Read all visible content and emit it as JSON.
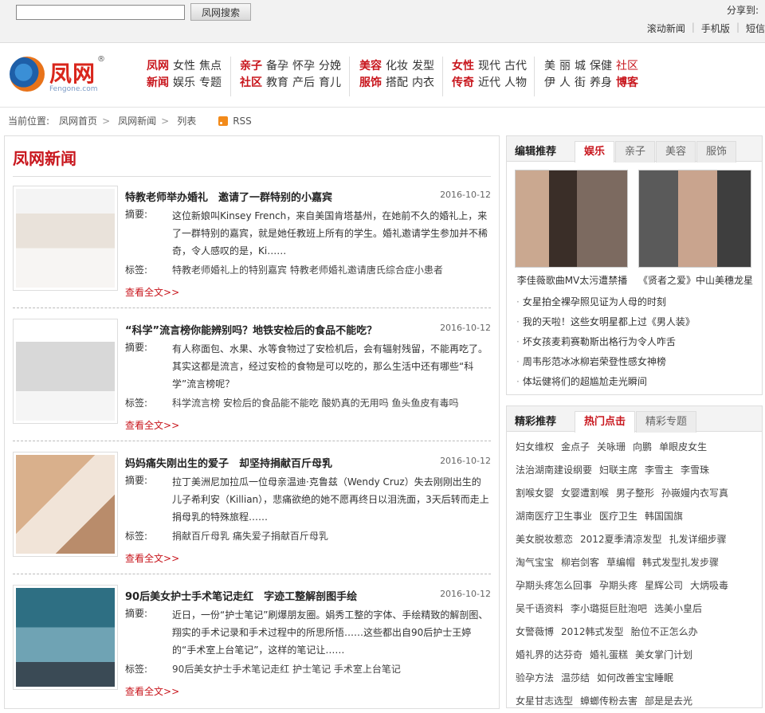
{
  "topbar": {
    "search_value": "",
    "search_button": "凤网搜索",
    "share_label": "分享到:",
    "links": [
      "滚动新闻",
      "手机版",
      "短信"
    ]
  },
  "logo": {
    "name": "凤网",
    "domain": "Fengone.com",
    "reg": "®"
  },
  "nav": {
    "groups": [
      {
        "row1": [
          {
            "t": "凤网",
            "hot": true
          },
          {
            "t": "女性"
          },
          {
            "t": "焦点"
          }
        ],
        "row2": [
          {
            "t": "新闻",
            "hot": true
          },
          {
            "t": "娱乐"
          },
          {
            "t": "专题"
          }
        ]
      },
      {
        "row1": [
          {
            "t": "亲子",
            "hot": true
          },
          {
            "t": "备孕"
          },
          {
            "t": "怀孕"
          },
          {
            "t": "分娩"
          }
        ],
        "row2": [
          {
            "t": "社区",
            "hot": true
          },
          {
            "t": "教育"
          },
          {
            "t": "产后"
          },
          {
            "t": "育儿"
          }
        ]
      },
      {
        "row1": [
          {
            "t": "美容",
            "hot": true
          },
          {
            "t": "化妆"
          },
          {
            "t": "发型"
          }
        ],
        "row2": [
          {
            "t": "服饰",
            "hot": true
          },
          {
            "t": "搭配"
          },
          {
            "t": "内衣"
          }
        ]
      },
      {
        "row1": [
          {
            "t": "女性",
            "hot": true
          },
          {
            "t": "现代"
          },
          {
            "t": "古代"
          }
        ],
        "row2": [
          {
            "t": "传奇",
            "hot": true
          },
          {
            "t": "近代"
          },
          {
            "t": "人物"
          }
        ]
      },
      {
        "row1": [
          {
            "t": "美"
          },
          {
            "t": "丽"
          },
          {
            "t": "城"
          },
          {
            "t": "保健"
          },
          {
            "t": "社区",
            "accent": true
          }
        ],
        "row2": [
          {
            "t": "伊"
          },
          {
            "t": "人"
          },
          {
            "t": "街"
          },
          {
            "t": "养身"
          },
          {
            "t": "博客",
            "hot": true
          }
        ]
      }
    ]
  },
  "breadcrumb": {
    "label": "当前位置:",
    "items": [
      "凤网首页",
      "凤网新闻",
      "列表"
    ],
    "rss": "RSS"
  },
  "main": {
    "title": "凤网新闻",
    "summary_label": "摘要:",
    "tags_label": "标签:",
    "more_label": "查看全文",
    "articles": [
      {
        "title": "特教老师举办婚礼　邀请了一群特别的小嘉宾",
        "date": "2016-10-12",
        "summary": "这位新娘叫Kinsey French，来自美国肯塔基州，在她前不久的婚礼上，来了一群特别的嘉宾，就是她任教班上所有的学生。婚礼邀请学生参加并不稀奇，令人感叹的是，Ki……",
        "tags": "特教老师婚礼上的特别嘉宾 特教老师婚礼邀请唐氏综合症小患者"
      },
      {
        "title": "“科学”流言榜你能辨别吗？地铁安检后的食品不能吃？",
        "date": "2016-10-12",
        "summary": "有人称面包、水果、水等食物过了安检机后，会有辐射残留，不能再吃了。其实这都是流言，经过安检的食物是可以吃的，那么生活中还有哪些“科学”流言榜呢？",
        "tags": "科学流言榜 安检后的食品能不能吃 酸奶真的无用吗 鱼头鱼皮有毒吗"
      },
      {
        "title": "妈妈痛失刚出生的爱子　却坚持捐献百斤母乳",
        "date": "2016-10-12",
        "summary": "拉丁美洲尼加拉瓜一位母亲温迪·克鲁兹（Wendy Cruz）失去刚刚出生的儿子希利安（Killian），悲痛欲绝的她不愿再终日以泪洗面，3天后转而走上捐母乳的特殊旅程……",
        "tags": "捐献百斤母乳 痛失爱子捐献百斤母乳"
      },
      {
        "title": "90后美女护士手术笔记走红　字迹工整解剖图手绘",
        "date": "2016-10-12",
        "summary": "近日，一份“护士笔记”刷爆朋友圈。娟秀工整的字体、手绘精致的解剖图、翔实的手术记录和手术过程中的所思所悟……这些都出自90后护士王婷的“手术室上台笔记”，这样的笔记让……",
        "tags": "90后美女护士手术笔记走红 护士笔记 手术室上台笔记"
      }
    ]
  },
  "editor_picks": {
    "title": "编辑推荐",
    "tabs": [
      "娱乐",
      "亲子",
      "美容",
      "服饰"
    ],
    "pics": [
      {
        "caption": "李佳薇歌曲MV太污遭禁播"
      },
      {
        "caption": "《贤者之爱》中山美穗龙星"
      }
    ],
    "list": [
      "女星拍全裸孕照见证为人母的时刻",
      "我的天啦！这些女明星都上过《男人装》",
      "坏女孩麦莉赛勒斯出格行为令人咋舌",
      "周韦彤范冰冰柳岩荣登性感女神榜",
      "体坛健将们的超尴尬走光瞬间"
    ]
  },
  "wonderful": {
    "title": "精彩推荐",
    "tabs": [
      "热门点击",
      "精彩专题"
    ],
    "rows": [
      [
        "妇女维权",
        "金点子",
        "关咏珊",
        "向鹏",
        "单眼皮女生"
      ],
      [
        "法治湖南建设纲要",
        "妇联主席",
        "李雪主",
        "李雪珠"
      ],
      [
        "割喉女婴",
        "女婴遭割喉",
        "男子整形",
        "孙嶶嫚内衣写真"
      ],
      [
        "湖南医疗卫生事业",
        "医疗卫生",
        "韩国国旗"
      ],
      [
        "美女脱妆惹恋",
        "2012夏季清凉发型",
        "扎发详细步骤"
      ],
      [
        "淘气宝宝",
        "柳岩剑客",
        "草编帽",
        "韩式发型扎发步骤"
      ],
      [
        "孕期头疼怎么回事",
        "孕期头疼",
        "星辉公司",
        "大炳吸毒"
      ],
      [
        "吴千语资料",
        "李小璐挺巨肚泡吧",
        "选美小皇后"
      ],
      [
        "女警薇博",
        "2012韩式发型",
        "胎位不正怎么办"
      ],
      [
        "婚礼界的达芬奇",
        "婚礼蛋糕",
        "美女掌门计划"
      ],
      [
        "验孕方法",
        "温莎结",
        "如何改善宝宝睡眠"
      ],
      [
        "女星甘志选型",
        "蟑螂传粉去害",
        "部是是去光"
      ]
    ]
  },
  "colors": {
    "brand_red": "#c8161d",
    "link_red": "#c8161d"
  }
}
